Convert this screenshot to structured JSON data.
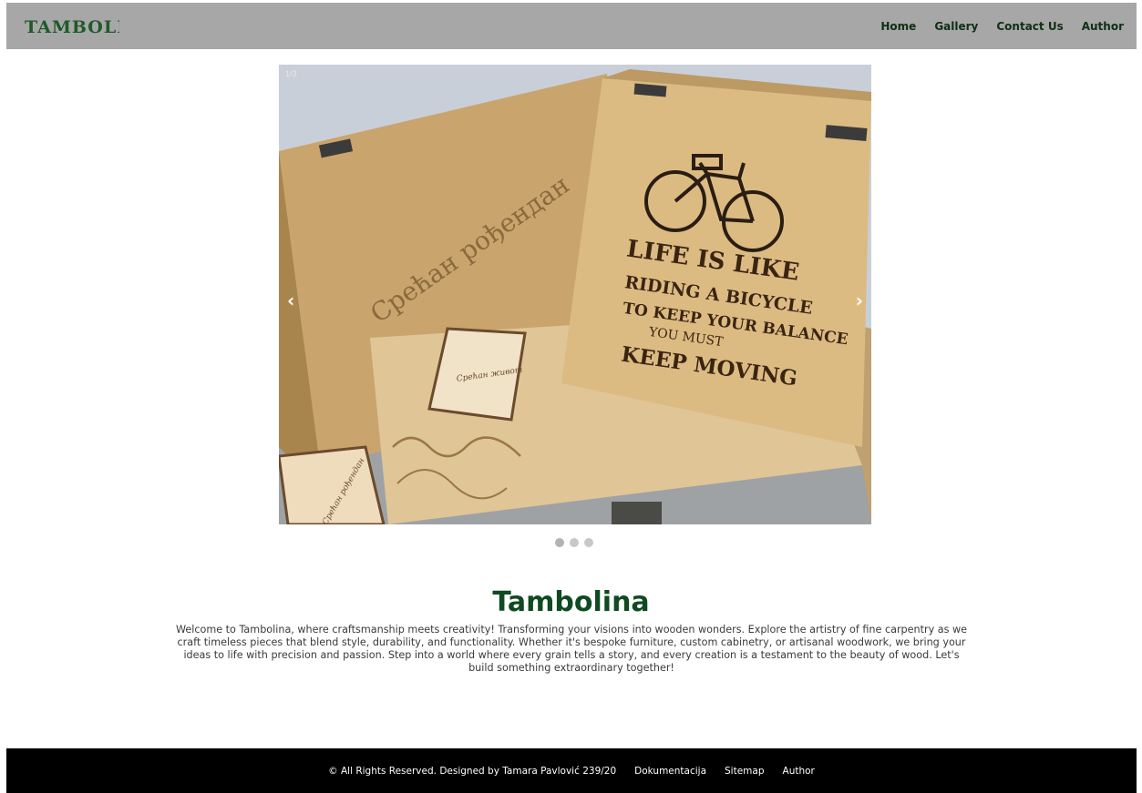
{
  "logo": {
    "text": "TAMBOLINA",
    "color": "#1f5a2a"
  },
  "nav": {
    "items": [
      {
        "label": "Home"
      },
      {
        "label": "Gallery"
      },
      {
        "label": "Contact Us"
      },
      {
        "label": "Author"
      }
    ]
  },
  "carousel": {
    "counter": "1/3",
    "prev_glyph": "‹",
    "next_glyph": "›",
    "dots": 3,
    "active_dot": 1,
    "image": {
      "box_left_text": "Срећан рођендан",
      "box_right_lines": [
        "LIFE IS LIKE",
        "RIDING A BICYCLE",
        "TO KEEP YOUR BALANCE",
        "YOU MUST",
        "KEEP MOVING"
      ],
      "small_box_text": "Срећан рођендан",
      "small_box_center_text": "Срећан живот"
    }
  },
  "main": {
    "title": "Tambolina",
    "intro": "Welcome to Tambolina, where craftsmanship meets creativity! Transforming your visions into wooden wonders. Explore the artistry of fine carpentry as we craft timeless pieces that blend style, durability, and functionality. Whether it's bespoke furniture, custom cabinetry, or artisanal woodwork, we bring your ideas to life with precision and passion. Step into a world where every grain tells a story, and every creation is a testament to the beauty of wood. Let's build something extraordinary together!"
  },
  "footer": {
    "copyright": "© All Rights Reserved. Designed by Tamara Pavlović 239/20",
    "links": [
      {
        "label": "Dokumentacija"
      },
      {
        "label": "Sitemap"
      },
      {
        "label": "Author"
      }
    ]
  },
  "colors": {
    "navbar_bg": "#a7a7a7",
    "heading": "#0f4a20",
    "footer_bg": "#000000"
  }
}
